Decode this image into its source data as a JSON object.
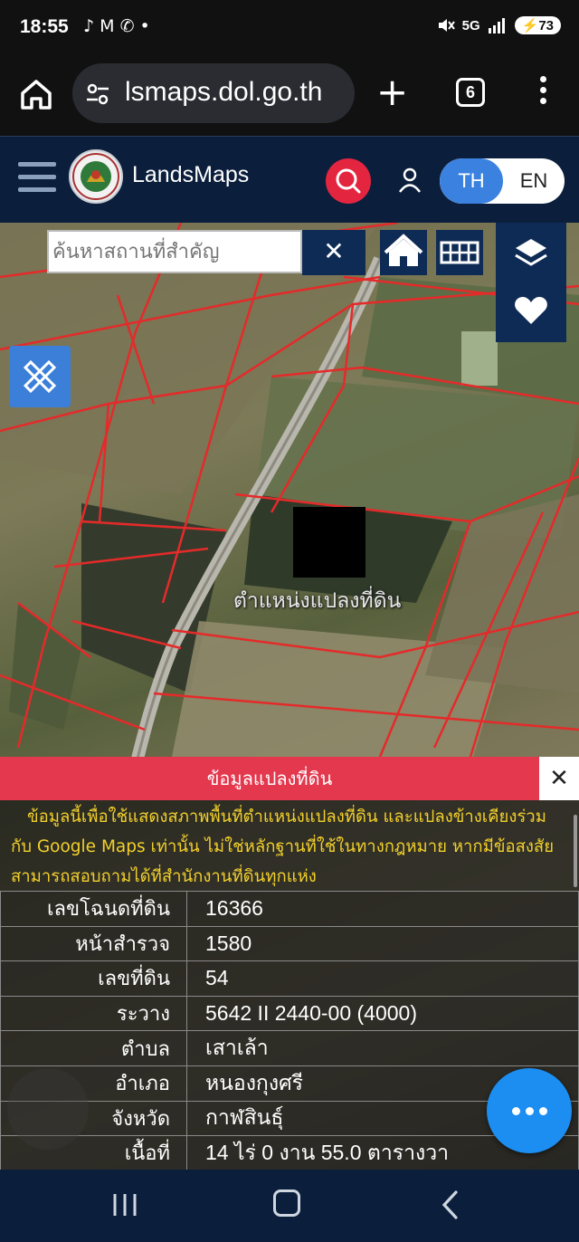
{
  "status_bar": {
    "time": "18:55",
    "notification_icons": "♪ M ✆ •",
    "network": "5G",
    "battery": "73"
  },
  "browser": {
    "url": "lsmaps.dol.go.th",
    "tab_count": "6"
  },
  "app": {
    "title": "LandsMaps",
    "lang_th": "TH",
    "lang_en": "EN",
    "accent_color": "#e3253f",
    "header_color": "#0b1f3d"
  },
  "map": {
    "search_placeholder": "ค้นหาสถานที่สำคัญ",
    "search_value": "",
    "clear_label": "✕",
    "parcel_label": "ตำแหน่งแปลงที่ดิน"
  },
  "info_panel": {
    "title": "ข้อมูลแปลงที่ดิน",
    "close_label": "✕",
    "disclaimer": "ข้อมูลนี้เพื่อใช้แสดงสภาพพื้นที่ตำแหน่งแปลงที่ดิน และแปลงข้างเคียงร่วมกับ Google Maps เท่านั้น ไม่ใช่หลักฐานที่ใช้ในทางกฎหมาย หากมีข้อสงสัยสามารถสอบถามได้ที่สำนักงานที่ดินทุกแห่ง",
    "rows": [
      {
        "key": "เลขโฉนดที่ดิน",
        "value": "16366"
      },
      {
        "key": "หน้าสำรวจ",
        "value": "1580"
      },
      {
        "key": "เลขที่ดิน",
        "value": "54"
      },
      {
        "key": "ระวาง",
        "value": "5642 II 2440-00 (4000)"
      },
      {
        "key": "ตำบล",
        "value": "เสาเล้า"
      },
      {
        "key": "อำเภอ",
        "value": "หนองกุงศรี"
      },
      {
        "key": "จังหวัด",
        "value": "กาฬสินธุ์"
      },
      {
        "key": "เนื้อที่",
        "value": "14 ไร่ 0 งาน 55.0 ตารางวา"
      }
    ]
  },
  "icons": {
    "home": "home-icon",
    "tune": "tune-icon",
    "search": "search-icon",
    "user": "user-icon",
    "layers": "layers-icon",
    "heart": "heart-icon",
    "ruler": "ruler-pencil-icon",
    "more": "more-horizontal-icon"
  }
}
